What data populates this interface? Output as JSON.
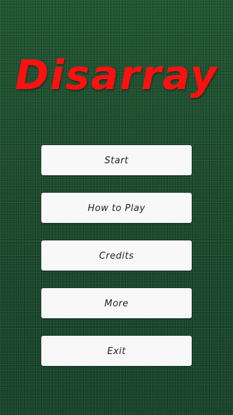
{
  "title": "Disarray",
  "menu": {
    "start": "Start",
    "how_to_play": "How to Play",
    "credits": "Credits",
    "more": "More",
    "exit": "Exit"
  },
  "colors": {
    "background": "#1c4e2e",
    "title": "#ff1010",
    "button": "#f8f8f8"
  }
}
